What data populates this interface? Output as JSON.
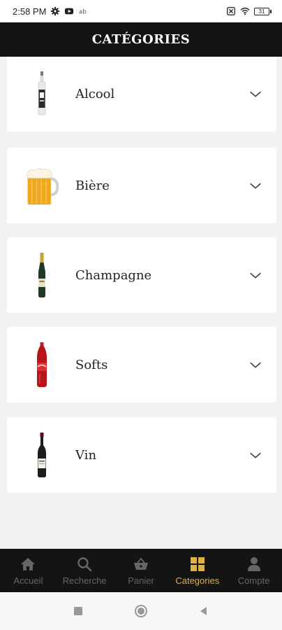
{
  "status_bar": {
    "time": "2:58 PM",
    "battery": "31"
  },
  "header": {
    "title": "CATÉGORIES"
  },
  "categories": [
    {
      "label": "Alcool",
      "icon": "liquor-bottle-icon"
    },
    {
      "label": "Bière",
      "icon": "beer-mug-icon"
    },
    {
      "label": "Champagne",
      "icon": "champagne-bottle-icon"
    },
    {
      "label": "Softs",
      "icon": "soda-bottle-icon"
    },
    {
      "label": "Vin",
      "icon": "wine-bottle-icon"
    }
  ],
  "bottom_nav": {
    "items": [
      {
        "label": "Accueil",
        "icon": "home-icon",
        "active": false
      },
      {
        "label": "Recherche",
        "icon": "search-icon",
        "active": false
      },
      {
        "label": "Panier",
        "icon": "basket-icon",
        "active": false
      },
      {
        "label": "Categories",
        "icon": "grid-icon",
        "active": true
      },
      {
        "label": "Compte",
        "icon": "user-icon",
        "active": false
      }
    ],
    "active_color": "#e0b042",
    "inactive_color": "#666666"
  },
  "colors": {
    "header_bg": "#141414",
    "page_bg": "#f2f2f2",
    "card_bg": "#ffffff"
  }
}
